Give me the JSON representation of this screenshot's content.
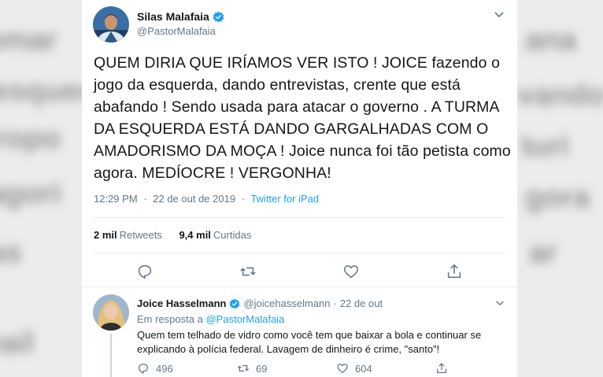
{
  "tweet": {
    "author_name": "Silas Malafaia",
    "author_handle": "@PastorMalafaia",
    "text": "QUEM DIRIA QUE IRÍAMOS VER ISTO ! JOICE fazendo o jogo da esquerda, dando entrevistas, crente que está abafando ! Sendo usada para atacar o governo . A TURMA DA ESQUERDA ESTÁ DANDO GARGALHADAS COM O AMADORISMO DA MOÇA ! Joice nunca foi tão petista como agora. MEDÍOCRE ! VERGONHA!",
    "time": "12:29 PM",
    "date": "22 de out de 2019",
    "separator": "·",
    "source": "Twitter for iPad",
    "retweets_count": "2 mil",
    "retweets_label": "Retweets",
    "likes_count": "9,4 mil",
    "likes_label": "Curtidas"
  },
  "reply": {
    "author_name": "Joice Hasselmann",
    "author_handle": "@joicehasselmann",
    "separator": "·",
    "time": "22 de out",
    "reply_prefix": "Em resposta a",
    "reply_mention": "@PastorMalafaia",
    "text": "Quem tem telhado de vidro como você tem que baixar a bola e continuar se explicando à polícia federal. Lavagem de dinheiro é crime, \"santo\"!",
    "reply_count": "496",
    "retweet_count": "69",
    "like_count": "604"
  },
  "colors": {
    "link": "#1da1f2",
    "secondary_text": "#657786",
    "verified": "#1da1f2"
  },
  "icons": {
    "reply": "speech-bubble",
    "retweet": "retweet-arrows",
    "like": "heart",
    "share": "upload-arrow",
    "menu": "chevron-down"
  }
}
